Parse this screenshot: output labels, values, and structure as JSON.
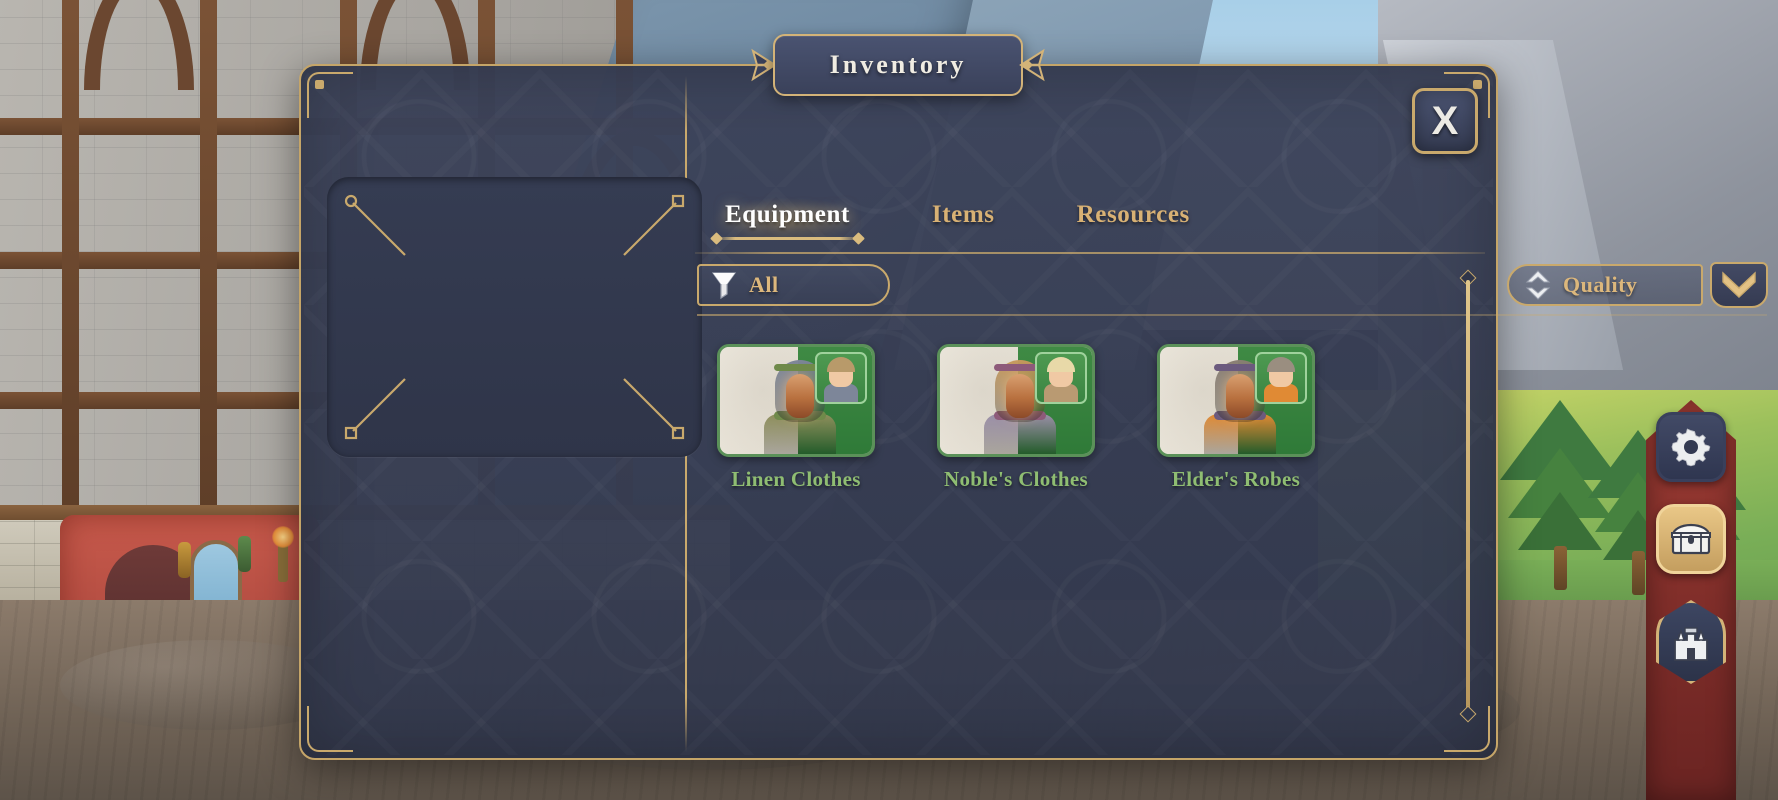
{
  "window": {
    "title": "Inventory",
    "close_label": "X"
  },
  "tabs": [
    {
      "label": "Equipment",
      "active": true
    },
    {
      "label": "Items",
      "active": false
    },
    {
      "label": "Resources",
      "active": false
    }
  ],
  "toolbar": {
    "filter": {
      "label": "All",
      "icon": "funnel-icon"
    },
    "sort": {
      "label": "Quality",
      "icon": "sort-updown-icon"
    },
    "sort_direction": {
      "icon": "chevron-down-icon"
    }
  },
  "character_slot": {
    "empty": true,
    "corner_ornament": "diagonal-pin"
  },
  "items": [
    {
      "name": "Linen Clothes",
      "rarity_color": "#5b9159",
      "name_color": "#8fbd72",
      "robe_color": "#8e8f5c",
      "hood_color": "#7d8699",
      "band_color": "#6f8a4a",
      "hair_color": "#b89a6a",
      "thumb_body_color": "#7d8699"
    },
    {
      "name": "Noble's Clothes",
      "rarity_color": "#5b9159",
      "name_color": "#8fbd72",
      "robe_color": "#9b8fa8",
      "hood_color": "#c79a5e",
      "band_color": "#8d5a7a",
      "hair_color": "#e8d9a8",
      "thumb_body_color": "#b99a72"
    },
    {
      "name": "Elder's Robes",
      "rarity_color": "#5b9159",
      "name_color": "#8fbd72",
      "robe_color": "#e08a34",
      "hood_color": "#8a7f74",
      "band_color": "#6b5a7e",
      "hair_color": "#9a8e80",
      "thumb_body_color": "#e08a34"
    }
  ],
  "scrollbar": {
    "position": "top"
  },
  "side_rail": [
    {
      "name": "settings",
      "icon": "gear-icon",
      "active": false
    },
    {
      "name": "inventory",
      "icon": "chest-icon",
      "active": true
    },
    {
      "name": "castle",
      "icon": "castle-icon",
      "active": false
    }
  ],
  "colors": {
    "gold": "#c9a96c",
    "gold_light": "#e0c68b",
    "panel_bg": "#3c435a",
    "tab_active": "#ffffff",
    "tab_inactive": "#d8b174",
    "rarity_uncommon": "#5b9159"
  }
}
